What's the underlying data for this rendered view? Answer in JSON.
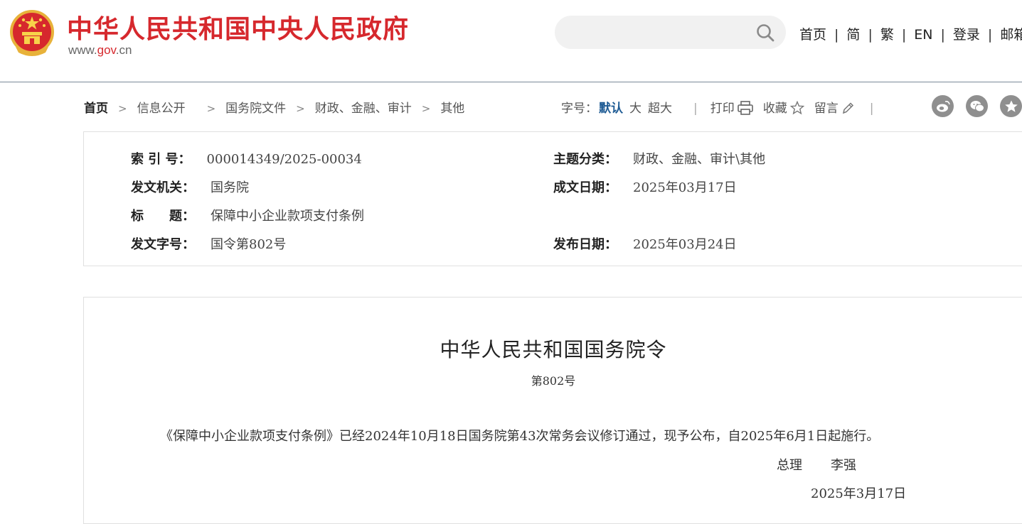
{
  "header": {
    "site_title": "中华人民共和国中央人民政府",
    "site_url_prefix": "www.",
    "site_url_mid": "gov",
    "site_url_suffix": ".cn",
    "search_placeholder": "",
    "nav": [
      "首页",
      "简",
      "繁",
      "EN",
      "登录",
      "邮箱"
    ],
    "brand_color": "#d6282d"
  },
  "breadcrumb": [
    "首页",
    "信息公开",
    "国务院文件",
    "财政、金融、审计",
    "其他"
  ],
  "toolbar": {
    "font_size_label": "字号：",
    "font_sizes": [
      "默认",
      "大",
      "超大"
    ],
    "print": "打印",
    "favorite": "收藏",
    "comment": "留言",
    "share_icons": [
      "weibo-icon",
      "wechat-icon",
      "qzone-icon"
    ]
  },
  "meta": {
    "index_label": "索 引 号：",
    "index_value": "000014349/2025-00034",
    "topic_label": "主题分类：",
    "topic_value": "财政、金融、审计\\其他",
    "issuer_label": "发文机关：",
    "issuer_value": "国务院",
    "written_date_label": "成文日期：",
    "written_date_value": "2025年03月17日",
    "title_label": "标　　题：",
    "title_value": "保障中小企业款项支付条例",
    "doc_no_label": "发文字号：",
    "doc_no_value": "国令第802号",
    "publish_date_label": "发布日期：",
    "publish_date_value": "2025年03月24日"
  },
  "article": {
    "title": "中华人民共和国国务院令",
    "number": "第802号",
    "body": "《保障中小企业款项支付条例》已经2024年10月18日国务院第43次常务会议修订通过，现予公布，自2025年6月1日起施行。",
    "signer_title": "总理",
    "signer_name": "李强",
    "date": "2025年3月17日"
  }
}
